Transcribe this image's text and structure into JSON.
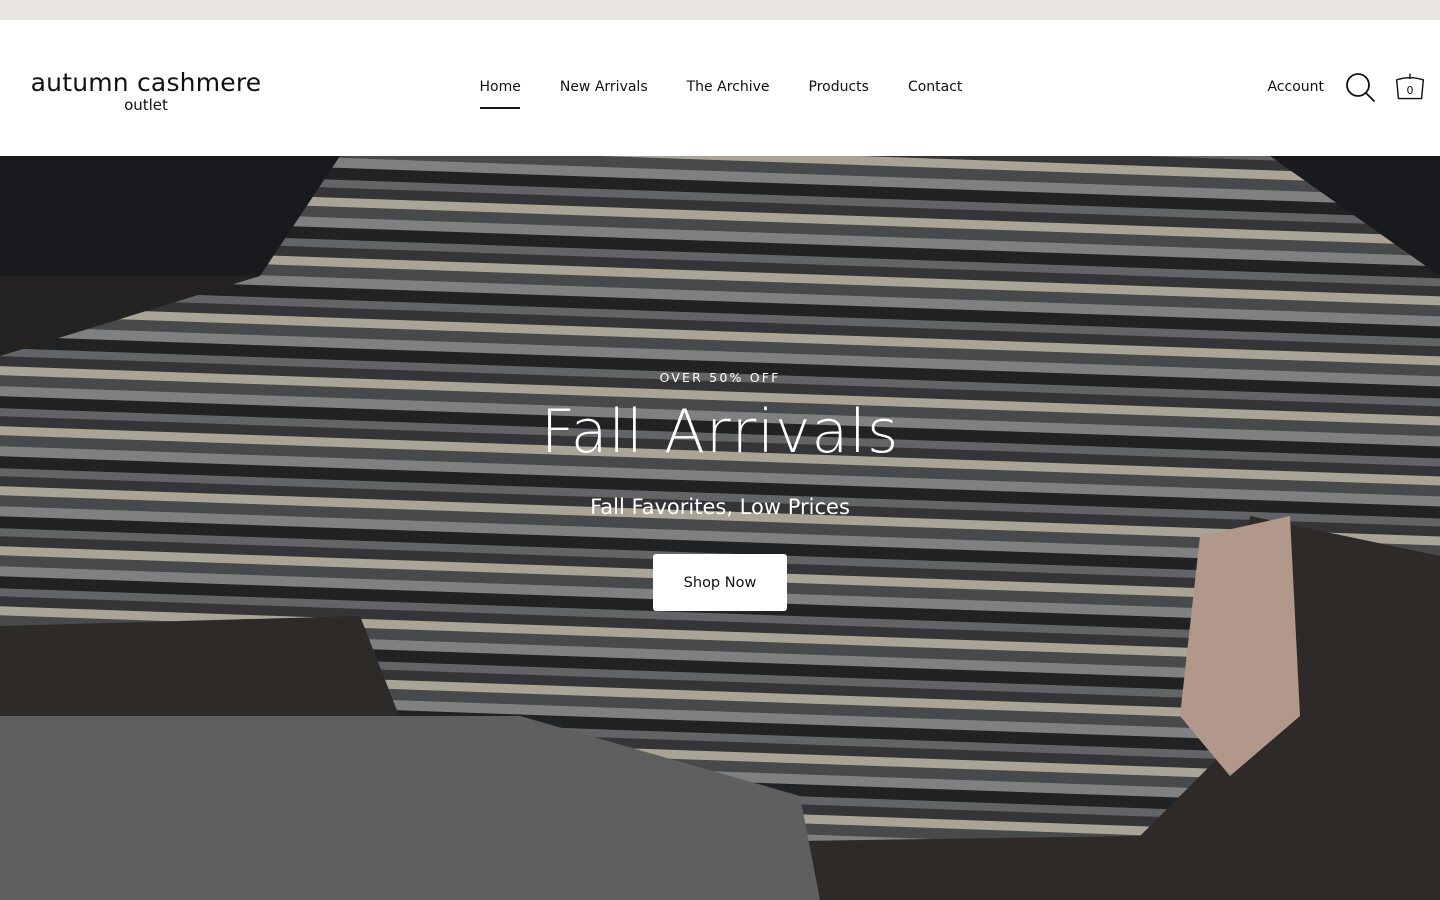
{
  "announcement": {
    "text": ""
  },
  "header": {
    "logo": {
      "line1": "autumn cashmere",
      "line2": "outlet"
    },
    "nav": [
      {
        "label": "Home",
        "active": true
      },
      {
        "label": "New Arrivals",
        "active": false
      },
      {
        "label": "The Archive",
        "active": false
      },
      {
        "label": "Products",
        "active": false
      },
      {
        "label": "Contact",
        "active": false
      }
    ],
    "account_label": "Account",
    "search_icon": "search-icon",
    "cart_icon": "cart-icon",
    "cart_count": "0"
  },
  "hero": {
    "eyebrow": "OVER 50% OFF",
    "title": "Fall Arrivals",
    "subtitle": "Fall Favorites, Low Prices",
    "button_label": "Shop Now",
    "image_description_colors": {
      "dark": "#2b2c2e",
      "charcoal": "#444548",
      "grey": "#7f8184",
      "cream": "#d9d2bf",
      "floor": "#3a3633"
    }
  },
  "colors": {
    "announcement_bg": "#e9e5e1",
    "header_bg": "#ffffff",
    "text": "#111111",
    "hero_text": "#ffffff",
    "button_bg": "#ffffff"
  }
}
